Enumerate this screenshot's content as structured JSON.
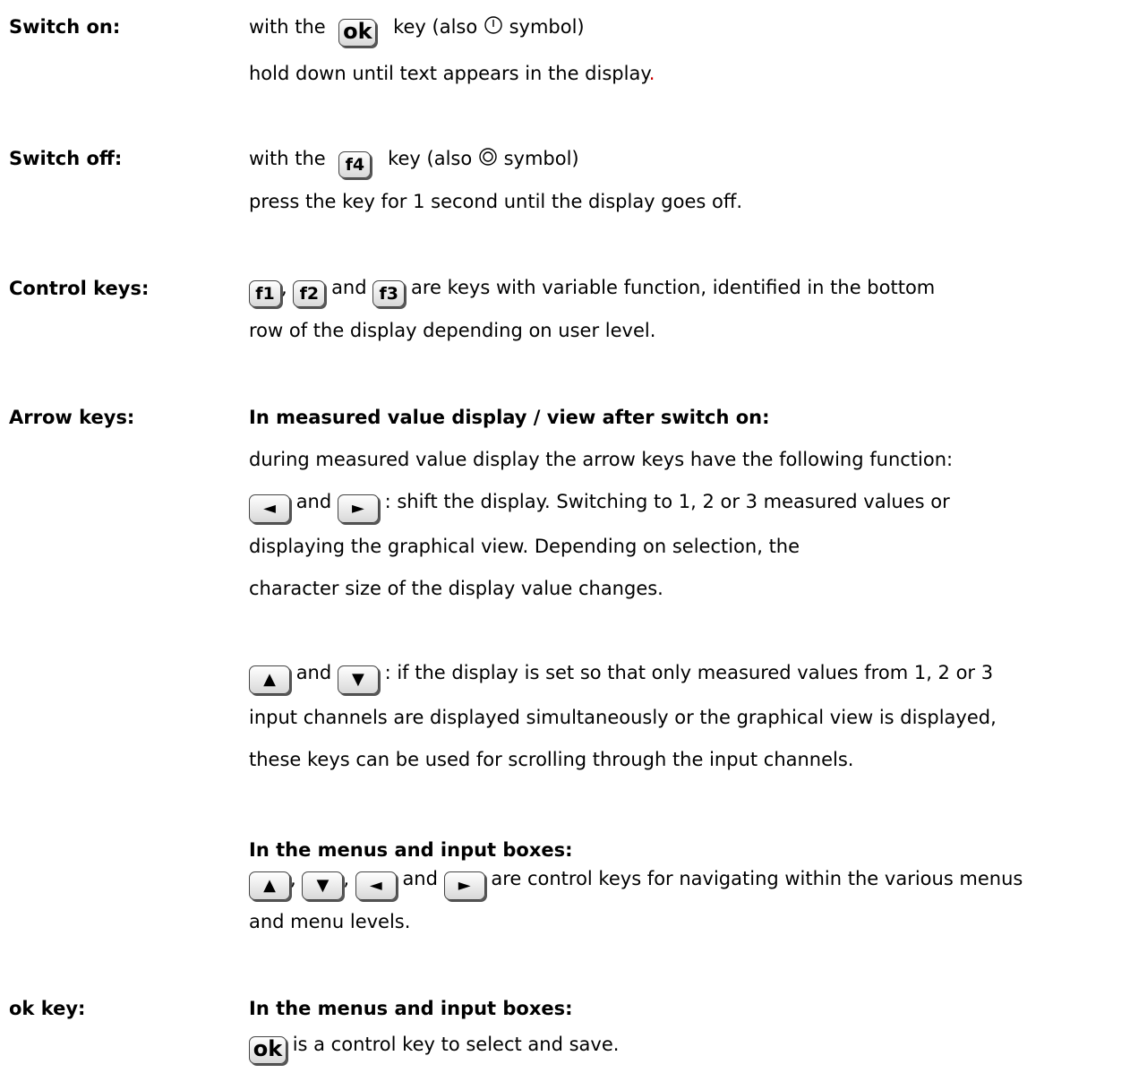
{
  "switch_on": {
    "label": "Switch on:",
    "line1_a": "with the",
    "key": "ok",
    "line1_b": "key (also",
    "line1_c": "symbol)",
    "line2": "hold down until text appears in the display",
    "line2_period": "."
  },
  "switch_off": {
    "label": "Switch off:",
    "line1_a": "with the",
    "key": "f4",
    "line1_b": "key (also",
    "line1_c": "symbol)",
    "line2": "press the key for 1 second until the display goes off."
  },
  "control_keys": {
    "label": "Control keys:",
    "key1": "f1",
    "sep1": ",",
    "key2": "f2",
    "and": "and",
    "key3": "f3",
    "line1_rest": "are keys with variable function, identified in the bottom",
    "line2": "row of the display depending on user level."
  },
  "arrow_keys": {
    "label": "Arrow keys:",
    "heading1": "In measured value display / view after switch on:",
    "p1_line1": "during measured value display the arrow keys have the following function:",
    "and": "and",
    "p1_line2_rest": ": shift the display. Switching to 1, 2 or 3 measured values or",
    "p1_line3": "displaying the graphical view. Depending on selection, the",
    "p1_line4": "character size of the display value changes.",
    "p2_line1_rest": ": if the display is set so that only measured values from 1, 2 or 3",
    "p2_line2": "input channels are displayed simultaneously or the graphical view is displayed,",
    "p2_line3": "these keys can be used for scrolling through the input channels.",
    "heading2": "In the menus and input boxes:",
    "comma": ",",
    "p3_line1_rest": "are control keys for navigating within the various menus",
    "p3_line2": "and menu levels."
  },
  "ok_key": {
    "label": "ok key:",
    "heading": "In the menus and input boxes:",
    "key": "ok",
    "line1_rest": "is a control key to select and save."
  },
  "icons": {
    "left": "◄",
    "right": "►",
    "up": "▲",
    "down": "▼"
  }
}
